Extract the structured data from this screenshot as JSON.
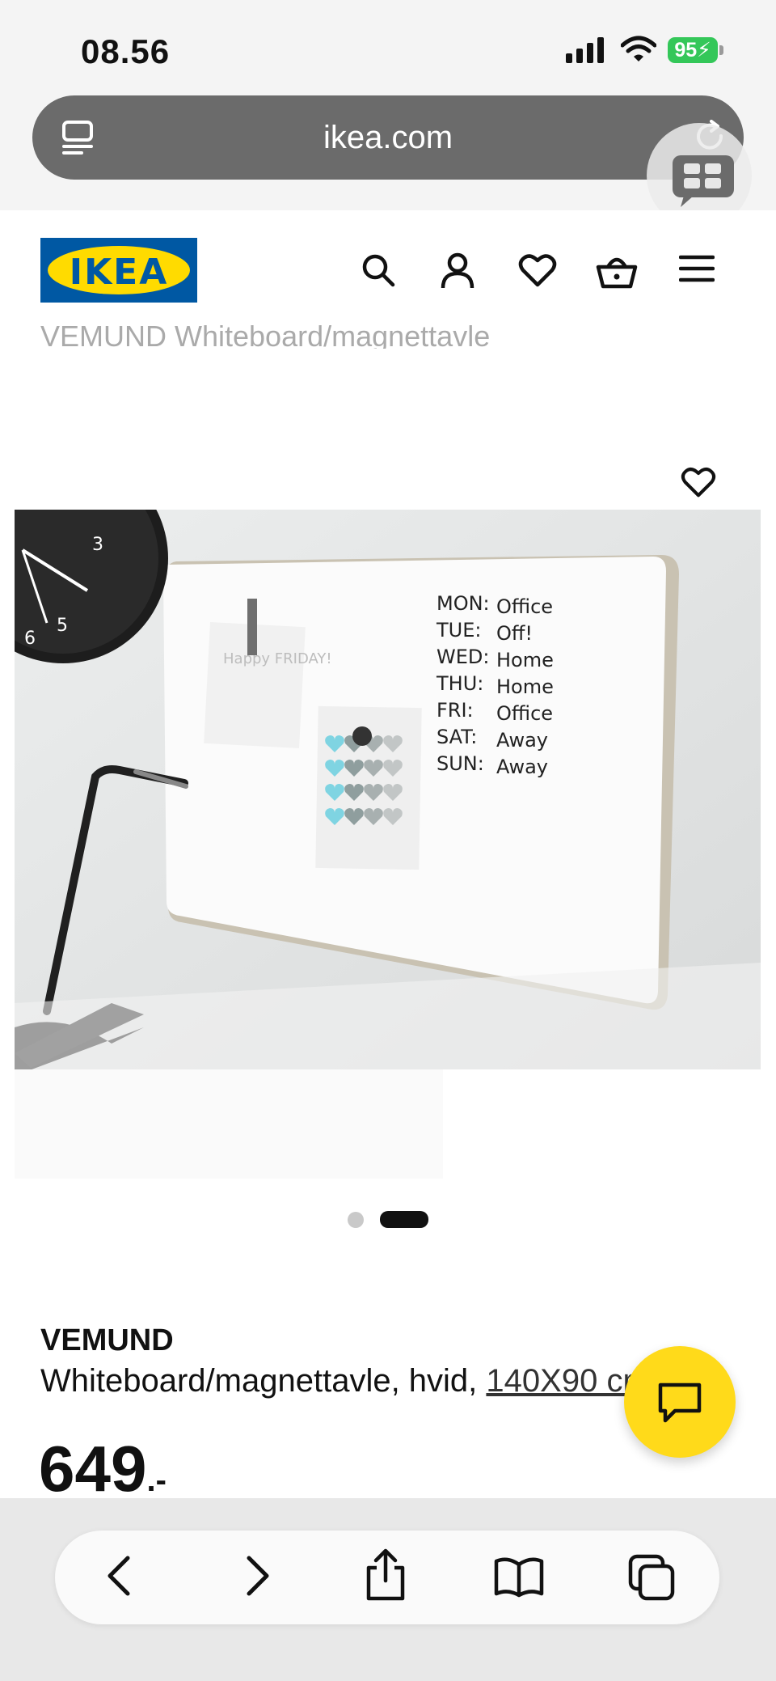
{
  "status_bar": {
    "time": "08.56",
    "battery": "95"
  },
  "browser": {
    "url": "ikea.com"
  },
  "header": {
    "logo_text": "IKEA"
  },
  "product": {
    "ghost_title": "VEMUND Whiteboard/magnettavle",
    "brand": "VEMUND",
    "description": "Whiteboard/magnettavle, hvid,",
    "size": "140X90 cm",
    "price": "649",
    "price_suffix": ".-"
  },
  "image": {
    "note_text": "Happy FRIDAY!",
    "schedule": [
      [
        "MON:",
        "Office"
      ],
      [
        "TUE:",
        "Off!"
      ],
      [
        "WED:",
        "Home"
      ],
      [
        "THU:",
        "Home"
      ],
      [
        "FRI:",
        "Office"
      ],
      [
        "SAT:",
        "Away"
      ],
      [
        "SUN:",
        "Away"
      ]
    ]
  },
  "carousel": {
    "slides": 2,
    "active": 2
  },
  "colors": {
    "ikea_blue": "#0058a3",
    "ikea_yellow": "#ffdb00",
    "chat_yellow": "#ffda1a"
  }
}
